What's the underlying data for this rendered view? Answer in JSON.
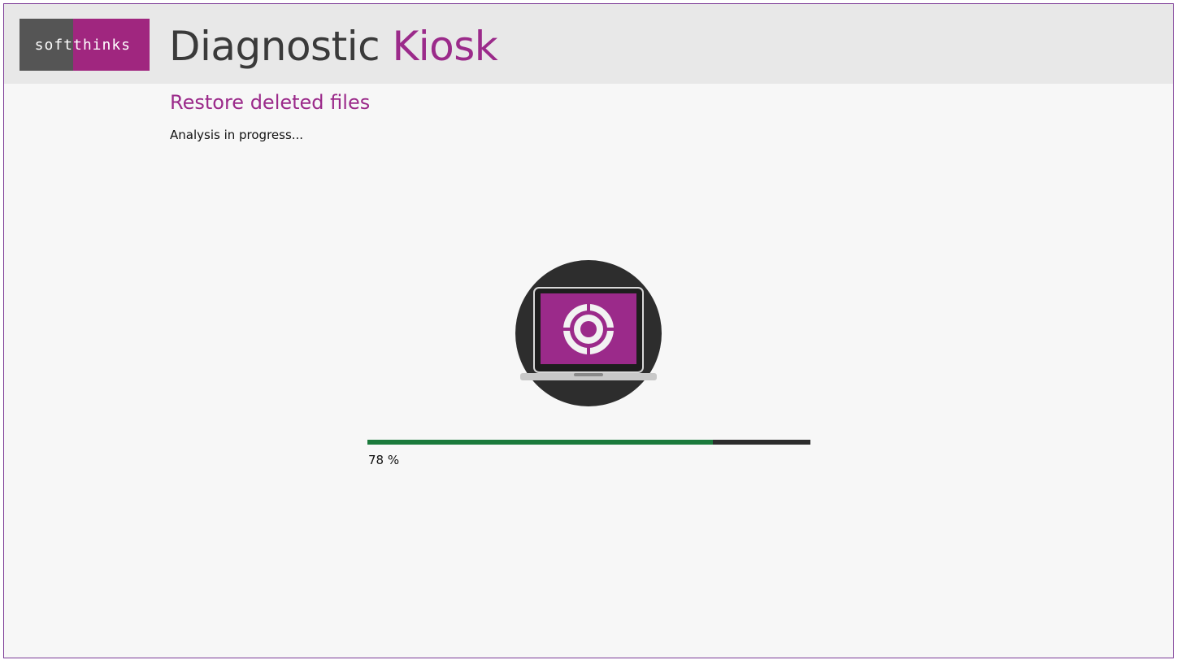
{
  "header": {
    "logo": {
      "left_text": "soft",
      "right_text": "thinks"
    },
    "title_main": "Diagnostic ",
    "title_accent": "Kiosk"
  },
  "page": {
    "title": "Restore deleted files",
    "status": "Analysis in progress..."
  },
  "illustration": {
    "icon": "laptop-recovery-icon"
  },
  "progress": {
    "value_fraction": 0.78,
    "label": "78 %"
  },
  "colors": {
    "accent": "#9b2a8a",
    "progress_fill": "#1b7a3c",
    "progress_track": "#2c2c2c",
    "header_bg": "#e8e8e8"
  }
}
